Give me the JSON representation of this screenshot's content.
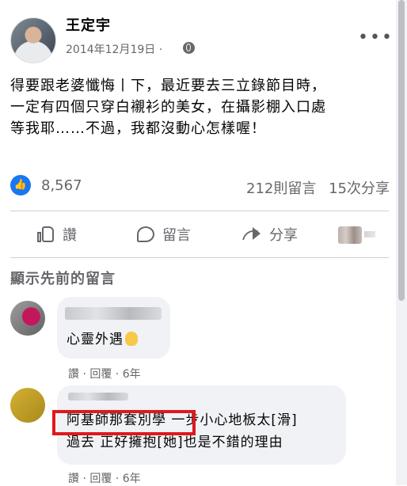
{
  "post": {
    "author": "王定宇",
    "date": "2014年12月19日 · ",
    "privacy_icon": "globe-icon",
    "more": "•••",
    "text_lines": [
      "得要跟老婆懺悔丨下，最近要去三立錄節目時，",
      "一定有四個只穿白襯衫的美女，在攝影棚入口處",
      "等我耶……不過，我都沒動心怎樣喔！"
    ]
  },
  "reactions": {
    "like_icon": "like-icon",
    "like_count": "8,567",
    "comments_count": "212則留言",
    "shares_count": "15次分享"
  },
  "actions": {
    "like": "讚",
    "comment": "留言",
    "share": "分享"
  },
  "comments_section": {
    "show_previous": "顯示先前的留言",
    "comments": [
      {
        "text": "心靈外遇",
        "emoji": "ok-hand-emoji",
        "meta": "讚 · 回覆 · 6年"
      },
      {
        "highlighted": "阿基師那套別學",
        "line1_rest": " 一步小心地板太[滑]",
        "line2": "過去 正好擁抱[她]也是不錯的理由",
        "meta": "讚 · 回覆 · 6年"
      }
    ]
  },
  "colors": {
    "accent": "#1877f2",
    "highlight_border": "#e0181d",
    "secondary_text": "#65676b",
    "bubble_bg": "#f0f2f5"
  }
}
